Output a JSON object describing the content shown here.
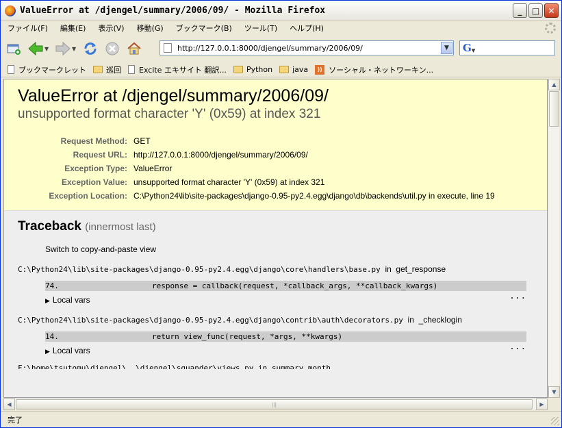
{
  "window": {
    "title": "ValueError at /djengel/summary/2006/09/ - Mozilla Firefox",
    "minimize": "_",
    "maximize": "□",
    "close": "✕"
  },
  "menu": [
    "ファイル(F)",
    "編集(E)",
    "表示(V)",
    "移動(G)",
    "ブックマーク(B)",
    "ツール(T)",
    "ヘルプ(H)"
  ],
  "toolbar": {
    "url": "http://127.0.0.1:8000/djengel/summary/2006/09/"
  },
  "bookmarks": [
    {
      "icon": "page",
      "label": "ブックマークレット"
    },
    {
      "icon": "folder",
      "label": "巡回"
    },
    {
      "icon": "page",
      "label": "Excite エキサイト 翻訳..."
    },
    {
      "icon": "folder",
      "label": "Python"
    },
    {
      "icon": "folder",
      "label": "java"
    },
    {
      "icon": "feed",
      "label": "ソーシャル・ネットワーキン..."
    }
  ],
  "error": {
    "title": "ValueError at /djengel/summary/2006/09/",
    "subtitle": "unsupported format character 'Y' (0x59) at index 321",
    "meta": [
      {
        "key": "Request Method:",
        "value": "GET"
      },
      {
        "key": "Request URL:",
        "value": "http://127.0.0.1:8000/djengel/summary/2006/09/"
      },
      {
        "key": "Exception Type:",
        "value": "ValueError"
      },
      {
        "key": "Exception Value:",
        "value": "unsupported format character 'Y' (0x59) at index 321"
      },
      {
        "key": "Exception Location:",
        "value": "C:\\Python24\\lib\\site-packages\\django-0.95-py2.4.egg\\django\\db\\backends\\util.py in execute, line 19"
      }
    ]
  },
  "traceback": {
    "title": "Traceback",
    "subtitle": "(innermost last)",
    "switch_label": "Switch to copy-and-paste view",
    "frames": [
      {
        "file": "C:\\Python24\\lib\\site-packages\\django-0.95-py2.4.egg\\django\\core\\handlers\\base.py",
        "in_text": "in",
        "func": "get_response",
        "line_no": "74.",
        "code": "response = callback(request, *callback_args, **callback_kwargs)",
        "more": "...",
        "locals_label": "Local vars"
      },
      {
        "file": "C:\\Python24\\lib\\site-packages\\django-0.95-py2.4.egg\\django\\contrib\\auth\\decorators.py",
        "in_text": "in",
        "func": "_checklogin",
        "line_no": "14.",
        "code": "return view_func(request, *args, **kwargs)",
        "more": "...",
        "locals_label": "Local vars"
      }
    ],
    "cut_line": "F:\\home\\tsutomu\\djengel\\..\\djengel\\squander\\views.py in summary_month"
  },
  "status": {
    "text": "完了"
  }
}
